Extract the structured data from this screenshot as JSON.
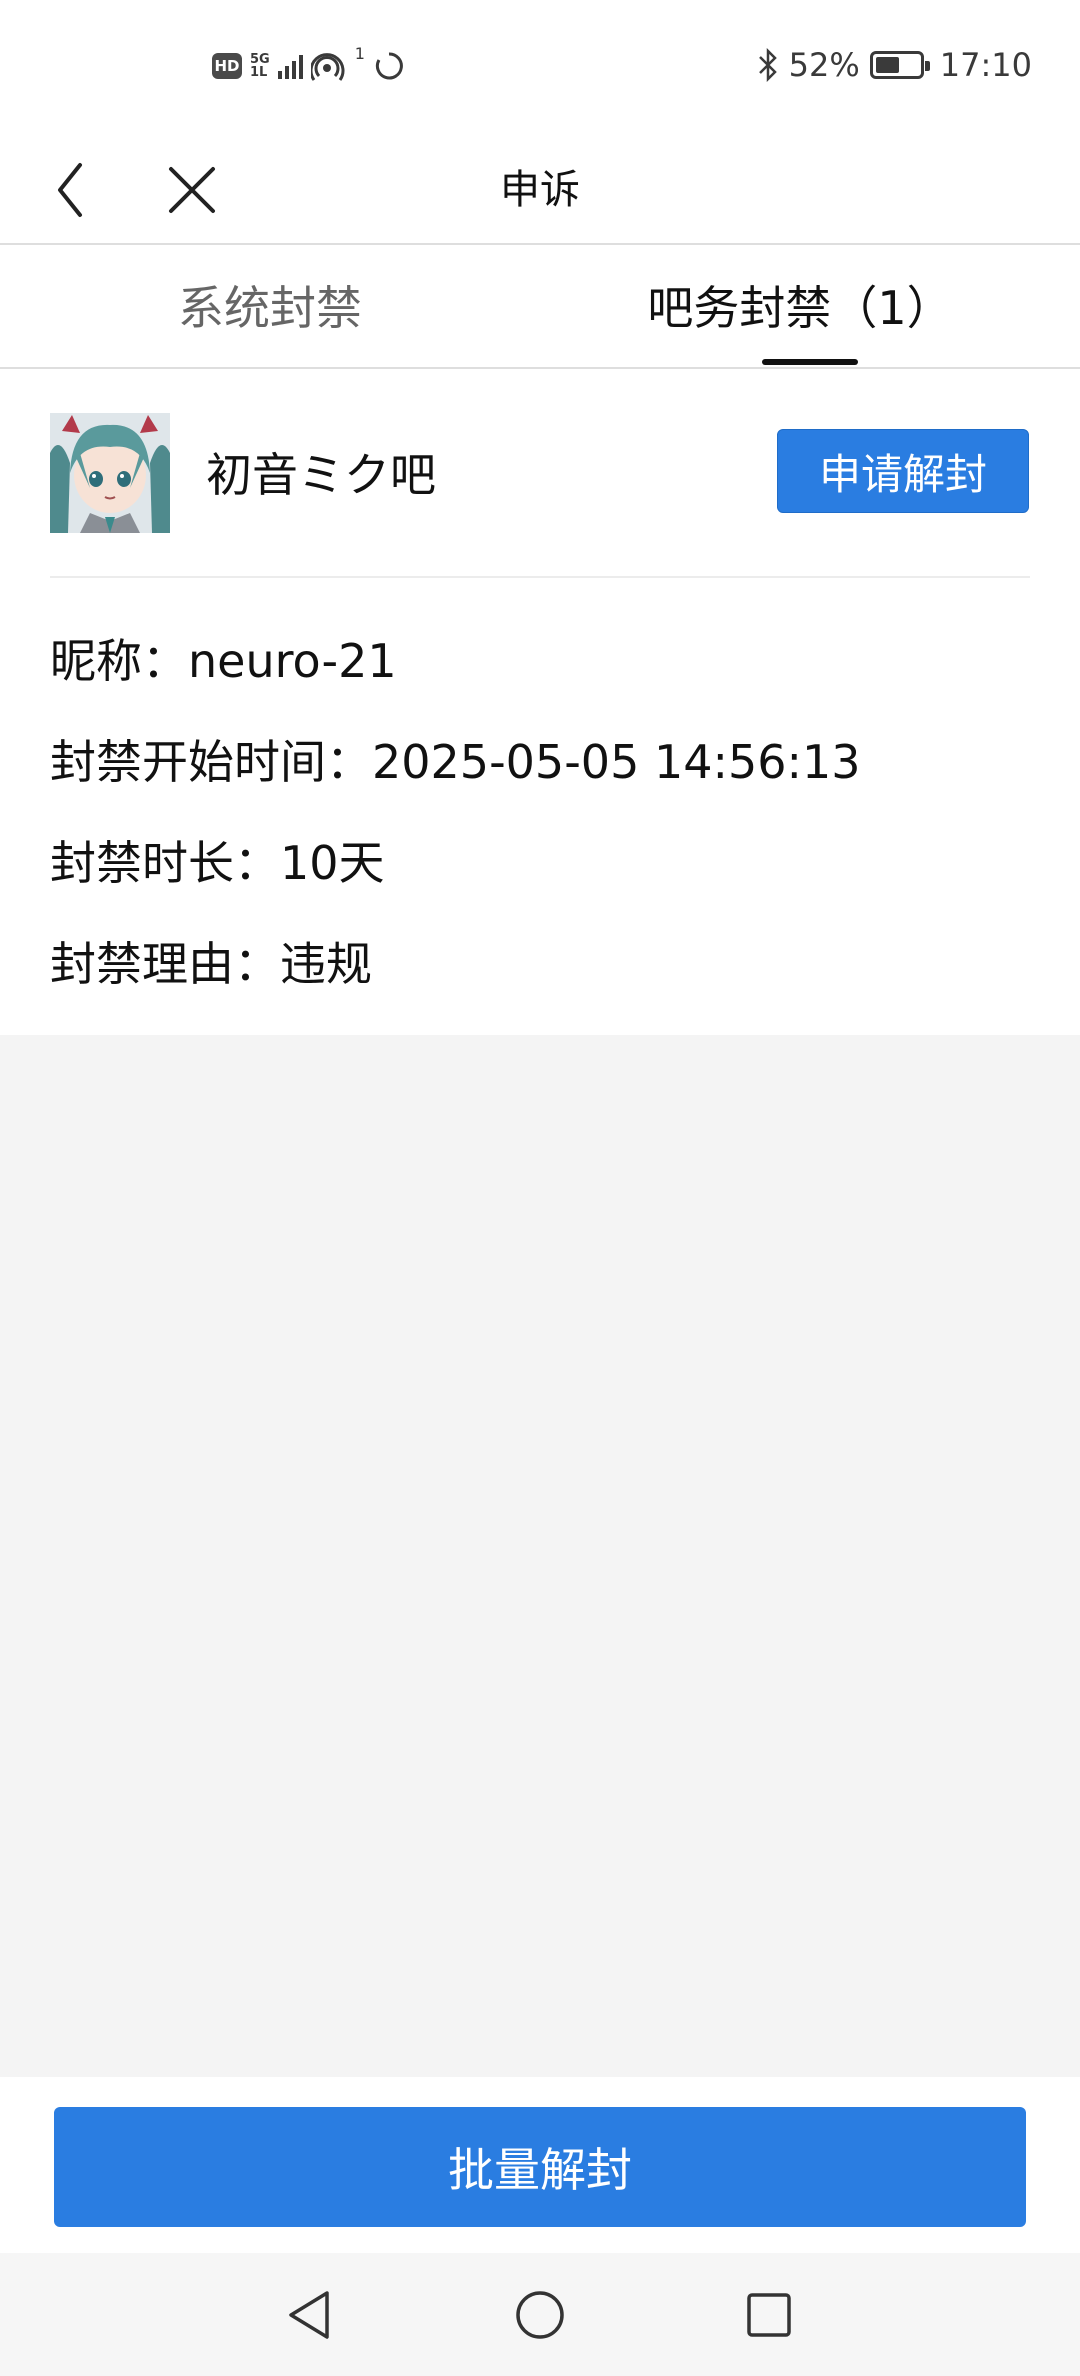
{
  "status_bar": {
    "hd": "HD",
    "network_top": "5G",
    "network_bottom": "1L",
    "hotspot_count": "1",
    "battery": "52%",
    "time": "17:10"
  },
  "title_bar": {
    "title": "申诉"
  },
  "tabs": [
    {
      "label": "系统封禁",
      "active": false
    },
    {
      "label": "吧务封禁（1）",
      "active": true
    }
  ],
  "ban_record": {
    "forum_name": "初音ミク吧",
    "appeal_button": "申请解封",
    "nickname": "昵称：neuro-21",
    "start_time": "封禁开始时间：2025-05-05 14:56:13",
    "duration": "封禁时长：10天",
    "reason": "封禁理由：违规"
  },
  "bottom": {
    "batch_button": "批量解封"
  },
  "colors": {
    "accent": "#2a7de1",
    "background_empty": "#f4f4f4"
  },
  "icons": [
    "back-arrow-icon",
    "close-icon",
    "bluetooth-icon",
    "battery-icon",
    "nav-back-icon",
    "nav-home-icon",
    "nav-recent-icon"
  ]
}
